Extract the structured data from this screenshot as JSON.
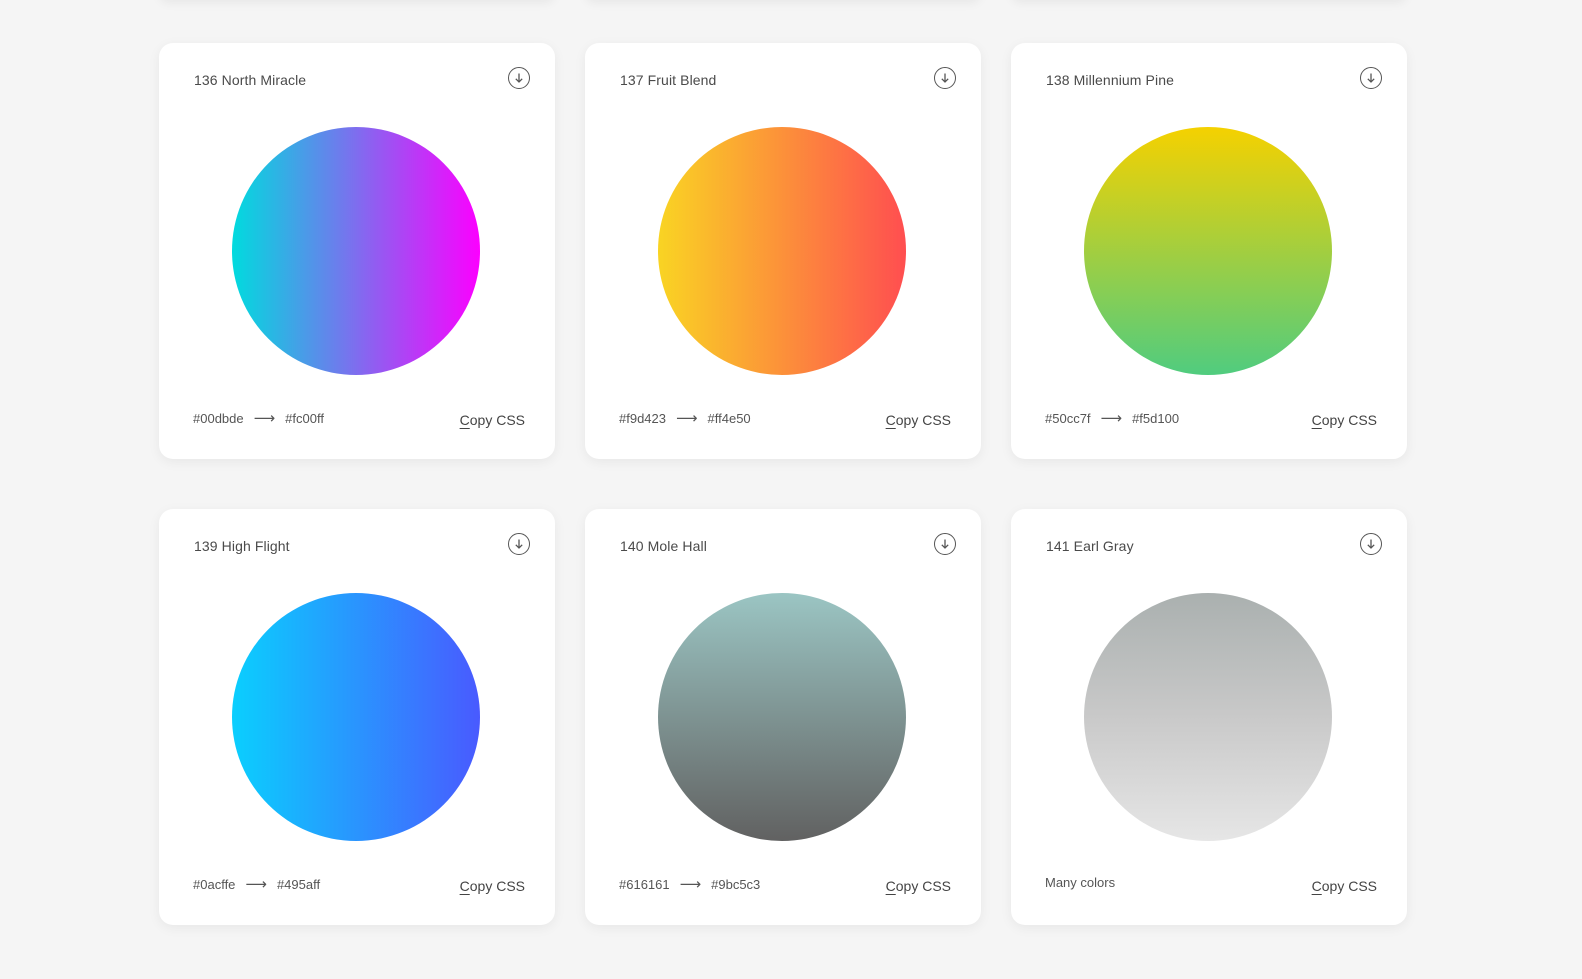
{
  "cards": [
    {
      "title": "136 North Miracle",
      "from": "#00dbde",
      "to": "#fc00ff",
      "arrow": "⟶",
      "copy_label": "Copy CSS",
      "gradient_direction": "to right",
      "gradient_colors": [
        "#00dbde",
        "#fc00ff"
      ]
    },
    {
      "title": "137 Fruit Blend",
      "from": "#f9d423",
      "to": "#ff4e50",
      "arrow": "⟶",
      "copy_label": "Copy CSS",
      "gradient_direction": "to right",
      "gradient_colors": [
        "#f9d423",
        "#ff4e50"
      ]
    },
    {
      "title": "138 Millennium Pine",
      "from": "#50cc7f",
      "to": "#f5d100",
      "arrow": "⟶",
      "copy_label": "Copy CSS",
      "gradient_direction": "to top",
      "gradient_colors": [
        "#50cc7f",
        "#f5d100"
      ]
    },
    {
      "title": "139 High Flight",
      "from": "#0acffe",
      "to": "#495aff",
      "arrow": "⟶",
      "copy_label": "Copy CSS",
      "gradient_direction": "to right",
      "gradient_colors": [
        "#0acffe",
        "#495aff"
      ]
    },
    {
      "title": "140 Mole Hall",
      "from": "#616161",
      "to": "#9bc5c3",
      "arrow": "⟶",
      "copy_label": "Copy CSS",
      "gradient_direction": "to top",
      "gradient_colors": [
        "#616161",
        "#9bc5c3"
      ]
    },
    {
      "title": "141 Earl Gray",
      "many_colors": "Many colors",
      "copy_label": "Copy CSS",
      "gradient_direction": "to top",
      "gradient_colors": [
        "#e6e6e6",
        "#c9c9c9",
        "#aab0af"
      ]
    }
  ]
}
